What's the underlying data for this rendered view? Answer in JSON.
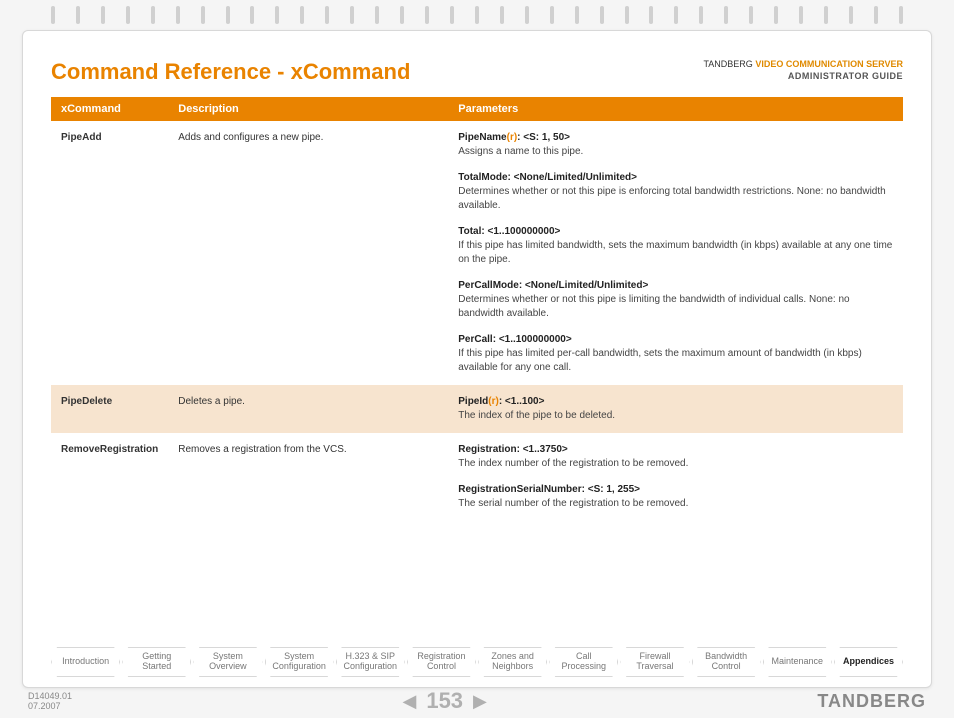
{
  "header": {
    "title": "Command Reference - xCommand",
    "brand": "TANDBERG",
    "product": "VIDEO COMMUNICATION SERVER",
    "sub": "ADMINISTRATOR GUIDE"
  },
  "table": {
    "cols": {
      "c1": "xCommand",
      "c2": "Description",
      "c3": "Parameters"
    },
    "rows": [
      {
        "name": "PipeAdd",
        "desc": "Adds and configures a new pipe.",
        "params": [
          {
            "label": "PipeName",
            "req": "(r)",
            "range": ": <S: 1, 50>",
            "desc": "Assigns a name to this pipe."
          },
          {
            "label": "TotalMode:",
            "req": "",
            "range": " <None/Limited/Unlimited>",
            "desc": "Determines whether or not this pipe is enforcing total bandwidth restrictions. None: no bandwidth available."
          },
          {
            "label": "Total:",
            "req": "",
            "range": " <1..100000000>",
            "desc": "If this pipe has limited bandwidth, sets the maximum bandwidth (in kbps) available at any one time on the pipe."
          },
          {
            "label": "PerCallMode:",
            "req": "",
            "range": " <None/Limited/Unlimited>",
            "desc": "Determines whether or not this pipe is limiting the bandwidth of individual calls. None: no bandwidth available."
          },
          {
            "label": "PerCall:",
            "req": "",
            "range": " <1..100000000>",
            "desc": "If this pipe has limited per-call bandwidth, sets the maximum amount of bandwidth (in kbps) available for any one call."
          }
        ]
      },
      {
        "name": "PipeDelete",
        "desc": "Deletes a pipe.",
        "params": [
          {
            "label": "PipeId",
            "req": "(r)",
            "range": ": <1..100>",
            "desc": "The index of the pipe to be deleted."
          }
        ]
      },
      {
        "name": "RemoveRegistration",
        "desc": "Removes a registration from the VCS.",
        "params": [
          {
            "label": "Registration:",
            "req": "",
            "range": " <1..3750>",
            "desc": "The index number of the registration to be removed."
          },
          {
            "label": "RegistrationSerialNumber:",
            "req": "",
            "range": " <S: 1, 255>",
            "desc": "The serial number of the registration to be removed."
          }
        ]
      }
    ]
  },
  "nav": {
    "items": [
      "Introduction",
      "Getting Started",
      "System Overview",
      "System Configuration",
      "H.323 & SIP Configuration",
      "Registration Control",
      "Zones and Neighbors",
      "Call Processing",
      "Firewall Traversal",
      "Bandwidth Control",
      "Maintenance",
      "Appendices"
    ],
    "active": "Appendices"
  },
  "footer": {
    "docid": "D14049.01",
    "date": "07.2007",
    "page": "153",
    "arrow_left": "◀",
    "arrow_right": "▶",
    "logo": "TANDBERG"
  }
}
